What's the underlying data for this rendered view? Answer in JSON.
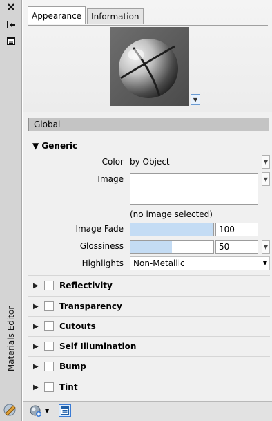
{
  "palette": {
    "title": "Materials Editor"
  },
  "tabs": [
    {
      "label": "Appearance",
      "active": true
    },
    {
      "label": "Information",
      "active": false
    }
  ],
  "material_name": "Global",
  "generic": {
    "heading": "Generic",
    "color_label": "Color",
    "color_value": "by Object",
    "image_label": "Image",
    "image_status": "(no image selected)",
    "image_fade_label": "Image Fade",
    "image_fade_value": "100",
    "image_fade_level": 1.0,
    "glossiness_label": "Glossiness",
    "glossiness_value": "50",
    "glossiness_level": 0.5,
    "highlights_label": "Highlights",
    "highlights_value": "Non-Metallic"
  },
  "sections": [
    "Reflectivity",
    "Transparency",
    "Cutouts",
    "Self Illumination",
    "Bump",
    "Tint"
  ],
  "colors": {
    "slider_fill": "#c4dcf4",
    "accent": "#3a7bd5"
  }
}
